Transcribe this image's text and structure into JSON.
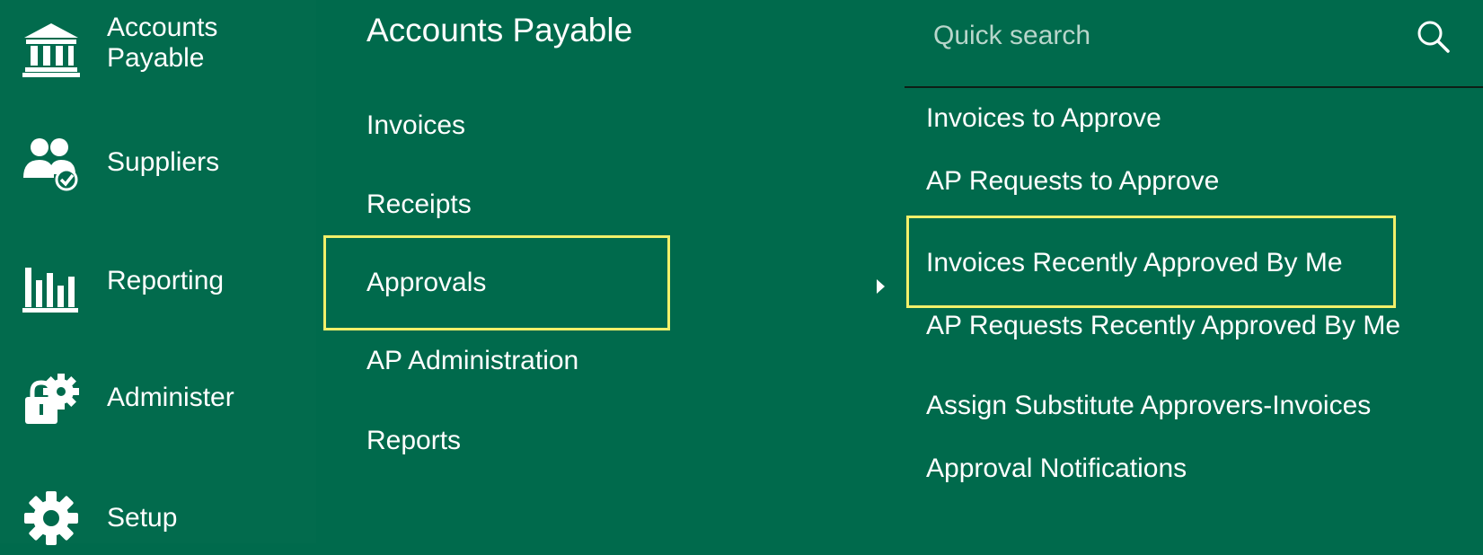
{
  "sidebar": {
    "items": [
      {
        "label": "Accounts\nPayable",
        "icon": "bank-icon"
      },
      {
        "label": "Suppliers",
        "icon": "suppliers-icon"
      },
      {
        "label": "Reporting",
        "icon": "bar-chart-icon"
      },
      {
        "label": "Administer",
        "icon": "lock-gear-icon"
      },
      {
        "label": "Setup",
        "icon": "gear-icon"
      }
    ]
  },
  "submenu": {
    "title": "Accounts Payable",
    "items": [
      "Invoices",
      "Receipts",
      "Approvals",
      "AP Administration",
      "Reports"
    ],
    "selected": "Approvals"
  },
  "search": {
    "placeholder": "Quick search"
  },
  "tasks": {
    "items": [
      "Invoices to Approve",
      "AP Requests to Approve",
      "Invoices Recently Approved By Me",
      "AP Requests Recently Approved By Me",
      "Assign Substitute Approvers-Invoices",
      "Approval Notifications"
    ]
  },
  "colors": {
    "background": "#006a4c",
    "sidebar": "#026b4d",
    "highlight": "#f2f06a",
    "text": "#ffffff",
    "placeholder": "#b8d6cb"
  }
}
